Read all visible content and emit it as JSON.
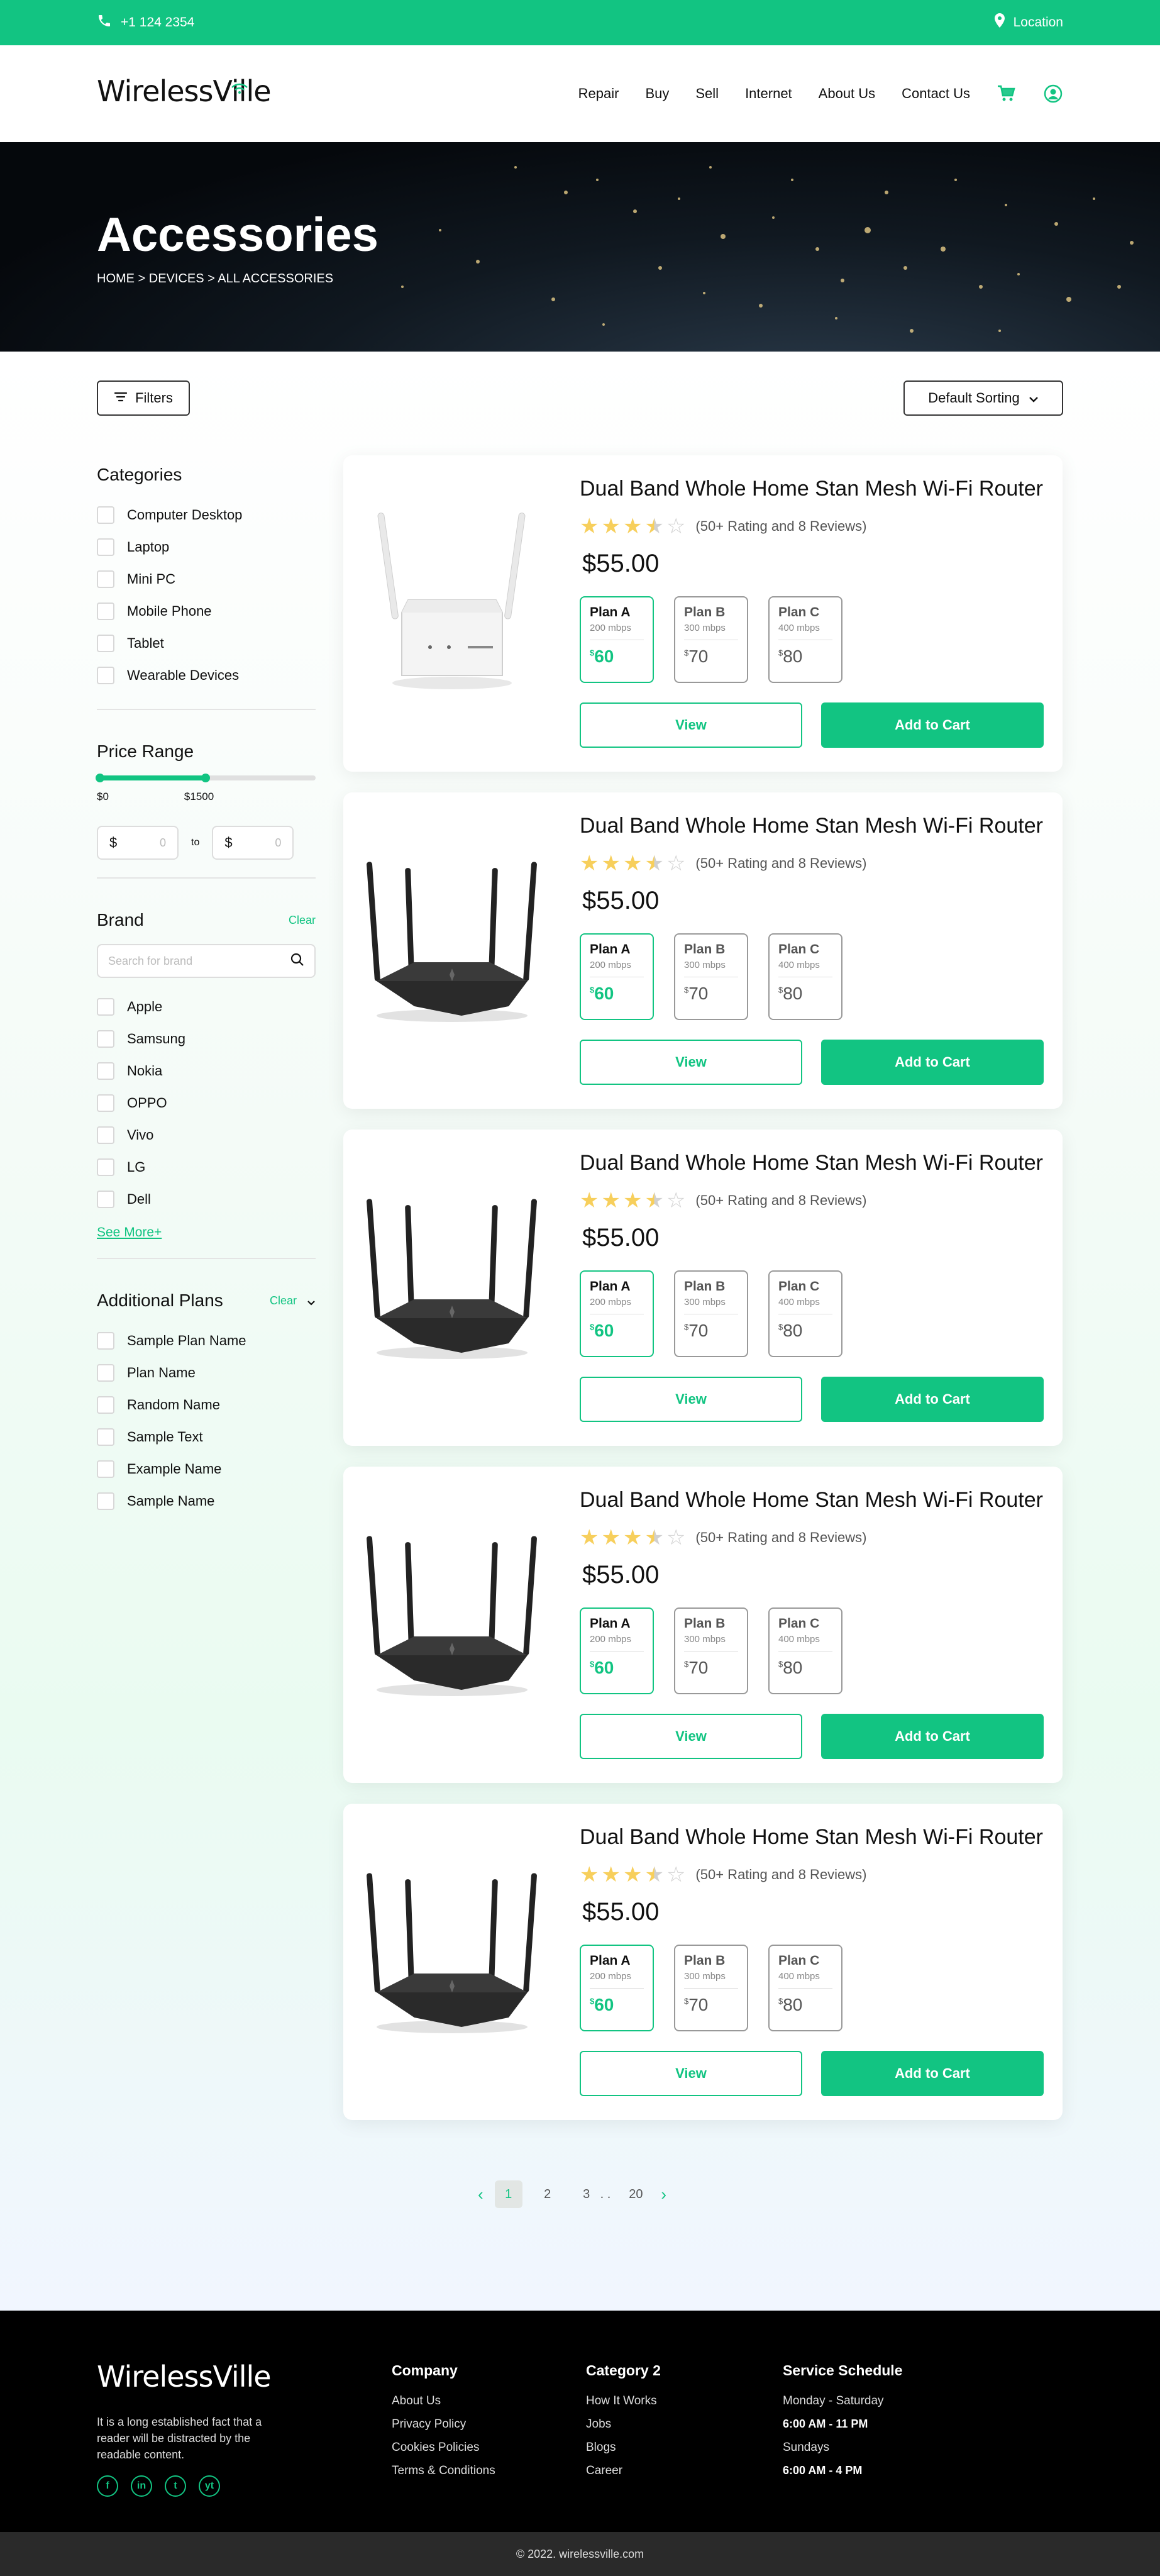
{
  "topbar": {
    "phone": "+1 124 2354",
    "location": "Location"
  },
  "header": {
    "logo": "WirelessVille",
    "nav": [
      "Repair",
      "Buy",
      "Sell",
      "Internet",
      "About Us",
      "Contact Us"
    ]
  },
  "hero": {
    "title": "Accessories",
    "breadcrumb": "HOME > DEVICES > ALL ACCESSORIES"
  },
  "toolbar": {
    "filters_label": "Filters",
    "sort_label": "Default Sorting"
  },
  "sidebar": {
    "categories_title": "Categories",
    "categories": [
      "Computer Desktop",
      "Laptop",
      "Mini PC",
      "Mobile Phone",
      "Tablet",
      "Wearable Devices"
    ],
    "price_title": "Price Range",
    "price_min_label": "$0",
    "price_max_label": "$1500",
    "price_fill_fraction": 0.5,
    "price_currency": "$",
    "price_placeholder": "0",
    "price_to": "to",
    "brand_title": "Brand",
    "brand_clear": "Clear",
    "brand_search_placeholder": "Search for brand",
    "brands": [
      "Apple",
      "Samsung",
      "Nokia",
      "OPPO",
      "Vivo",
      "LG",
      "Dell"
    ],
    "see_more": "See More+",
    "plans_title": "Additional Plans",
    "plans_clear": "Clear",
    "plans": [
      "Sample Plan Name",
      "Plan Name",
      "Random Name",
      "Sample Text",
      "Example Name",
      "Sample Name"
    ]
  },
  "products": [
    {
      "title": "Dual Band Whole Home Stan Mesh Wi-Fi Router",
      "rating_stars": 3.5,
      "rating_text": "(50+ Rating and 8 Reviews)",
      "price": "$55.00",
      "image": "white-router",
      "plans": [
        {
          "name": "Plan A",
          "speed": "200 mbps",
          "cur": "$",
          "price": "60"
        },
        {
          "name": "Plan B",
          "speed": "300 mbps",
          "cur": "$",
          "price": "70"
        },
        {
          "name": "Plan C",
          "speed": "400 mbps",
          "cur": "$",
          "price": "80"
        }
      ],
      "view_label": "View",
      "cart_label": "Add to Cart"
    },
    {
      "title": "Dual Band Whole Home Stan Mesh Wi-Fi Router",
      "rating_stars": 3.5,
      "rating_text": "(50+ Rating and 8 Reviews)",
      "price": "$55.00",
      "image": "black-router",
      "plans": [
        {
          "name": "Plan A",
          "speed": "200 mbps",
          "cur": "$",
          "price": "60"
        },
        {
          "name": "Plan B",
          "speed": "300 mbps",
          "cur": "$",
          "price": "70"
        },
        {
          "name": "Plan C",
          "speed": "400 mbps",
          "cur": "$",
          "price": "80"
        }
      ],
      "view_label": "View",
      "cart_label": "Add to Cart"
    },
    {
      "title": "Dual Band Whole Home Stan Mesh Wi-Fi Router",
      "rating_stars": 3.5,
      "rating_text": "(50+ Rating and 8 Reviews)",
      "price": "$55.00",
      "image": "black-router",
      "plans": [
        {
          "name": "Plan A",
          "speed": "200 mbps",
          "cur": "$",
          "price": "60"
        },
        {
          "name": "Plan B",
          "speed": "300 mbps",
          "cur": "$",
          "price": "70"
        },
        {
          "name": "Plan C",
          "speed": "400 mbps",
          "cur": "$",
          "price": "80"
        }
      ],
      "view_label": "View",
      "cart_label": "Add to Cart"
    },
    {
      "title": "Dual Band Whole Home Stan Mesh Wi-Fi Router",
      "rating_stars": 3.5,
      "rating_text": "(50+ Rating and 8 Reviews)",
      "price": "$55.00",
      "image": "black-router",
      "plans": [
        {
          "name": "Plan A",
          "speed": "200 mbps",
          "cur": "$",
          "price": "60"
        },
        {
          "name": "Plan B",
          "speed": "300 mbps",
          "cur": "$",
          "price": "70"
        },
        {
          "name": "Plan C",
          "speed": "400 mbps",
          "cur": "$",
          "price": "80"
        }
      ],
      "view_label": "View",
      "cart_label": "Add to Cart"
    },
    {
      "title": "Dual Band Whole Home Stan Mesh Wi-Fi Router",
      "rating_stars": 3.5,
      "rating_text": "(50+ Rating and 8 Reviews)",
      "price": "$55.00",
      "image": "black-router",
      "plans": [
        {
          "name": "Plan A",
          "speed": "200 mbps",
          "cur": "$",
          "price": "60"
        },
        {
          "name": "Plan B",
          "speed": "300 mbps",
          "cur": "$",
          "price": "70"
        },
        {
          "name": "Plan C",
          "speed": "400 mbps",
          "cur": "$",
          "price": "80"
        }
      ],
      "view_label": "View",
      "cart_label": "Add to Cart"
    }
  ],
  "pagination": {
    "pages": [
      "1",
      "2",
      "3",
      "20"
    ],
    "ellipsis": ". .",
    "current": "1"
  },
  "footer": {
    "logo": "WirelessVille",
    "description": "It is a long established fact that a reader will be distracted by the readable content.",
    "social": [
      "f",
      "in",
      "t",
      "yt"
    ],
    "company_title": "Company",
    "company_links": [
      "About Us",
      "Privacy Policy",
      "Cookies Policies",
      "Terms & Conditions"
    ],
    "category_title": "Category 2",
    "category_links": [
      "How It Works",
      "Jobs",
      "Blogs",
      "Career"
    ],
    "schedule_title": "Service Schedule",
    "schedule": {
      "weekday_label": "Monday - Saturday",
      "weekday_hours": "6:00 AM - 11 PM",
      "sunday_label": "Sundays",
      "sunday_hours": "6:00 AM - 4 PM"
    }
  },
  "copyright": "© 2022. wirelessville.com",
  "colors": {
    "accent": "#12c482",
    "star": "#f7cf5c",
    "footer_bg": "#000000"
  }
}
